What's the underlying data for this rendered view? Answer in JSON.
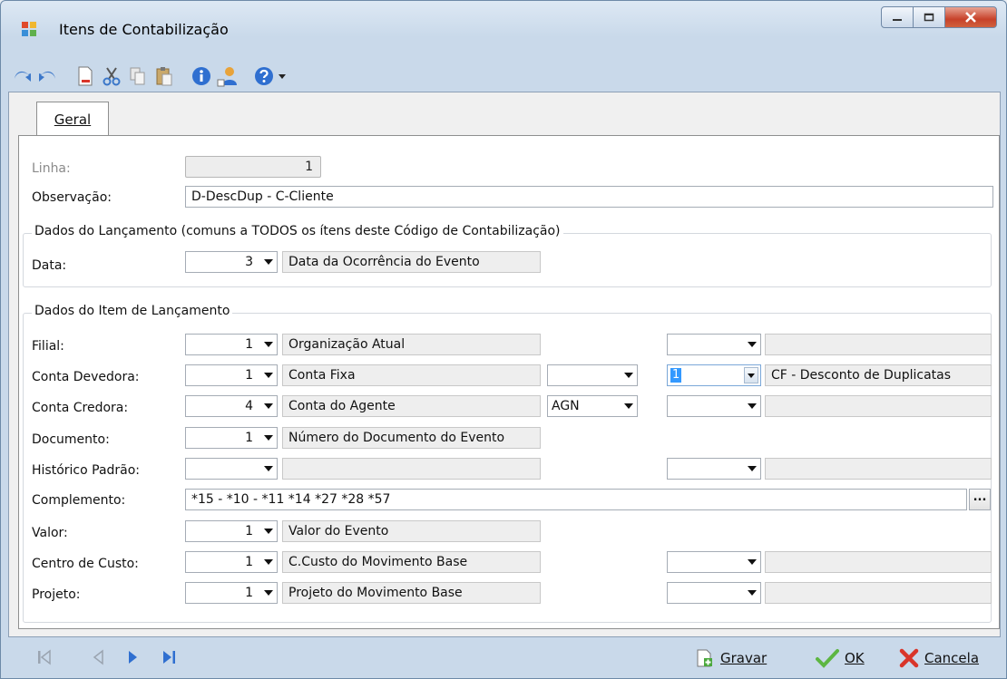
{
  "window": {
    "title": "Itens de Contabilização"
  },
  "tabs": [
    {
      "label": "Geral"
    }
  ],
  "form": {
    "linha_label": "Linha:",
    "linha_value": "1",
    "observacao_label": "Observação:",
    "observacao_value": "D-DescDup - C-Cliente",
    "group1_title": "Dados do Lançamento (comuns a TODOS os ítens deste Código de Contabilização)",
    "data_label": "Data:",
    "data_value": "3",
    "data_desc": "Data da Ocorrência do Evento",
    "group2_title": "Dados do Item de Lançamento",
    "rows": {
      "filial": {
        "label": "Filial:",
        "value": "1",
        "desc": "Organização Atual"
      },
      "conta_devedora": {
        "label": "Conta Devedora:",
        "value": "1",
        "desc": "Conta Fixa",
        "sel": "1",
        "sel_desc": "CF - Desconto de Duplicatas"
      },
      "conta_credora": {
        "label": "Conta Credora:",
        "value": "4",
        "desc": "Conta do Agente",
        "mid": "AGN"
      },
      "documento": {
        "label": "Documento:",
        "value": "1",
        "desc": "Número do Documento do Evento"
      },
      "historico": {
        "label": "Histórico Padrão:"
      },
      "complemento": {
        "label": "Complemento:",
        "value": "*15 - *10 - *11 *14 *27 *28 *57",
        "btn": "..."
      },
      "valor": {
        "label": "Valor:",
        "value": "1",
        "desc": "Valor do Evento"
      },
      "centro": {
        "label": "Centro de Custo:",
        "value": "1",
        "desc": "C.Custo do Movimento Base"
      },
      "projeto": {
        "label": "Projeto:",
        "value": "1",
        "desc": "Projeto do Movimento Base"
      }
    }
  },
  "actions": {
    "gravar_label": "Gravar",
    "ok_label": "OK",
    "cancel_label": "Cancela"
  },
  "colors": {
    "close_button": "#c7422a",
    "selection": "#3399ff",
    "nav_arrows": "#2f6fd0"
  }
}
